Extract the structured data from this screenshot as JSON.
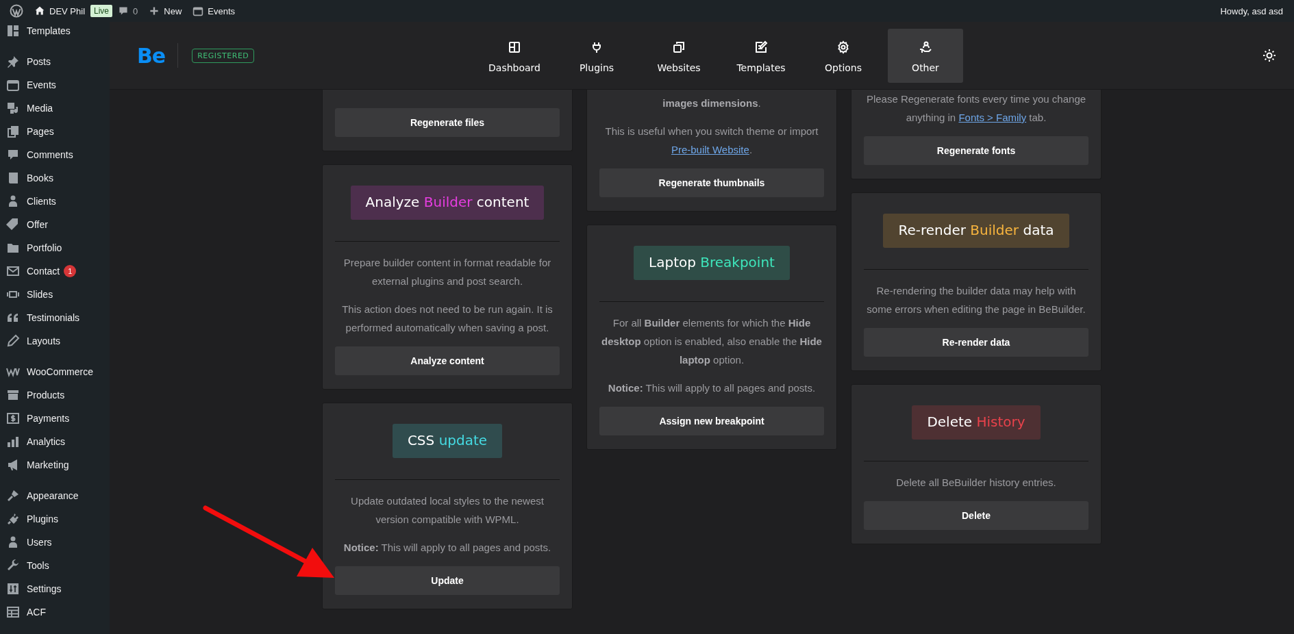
{
  "admin_bar": {
    "site_name": "DEV Phil",
    "live_badge": "Live",
    "comments_count": "0",
    "new_label": "New",
    "events_label": "Events",
    "howdy": "Howdy, asd asd"
  },
  "sidebar": {
    "groups": [
      {
        "items": [
          {
            "label": "Templates"
          }
        ]
      },
      {
        "items": [
          {
            "label": "Posts"
          },
          {
            "label": "Events"
          },
          {
            "label": "Media"
          },
          {
            "label": "Pages"
          },
          {
            "label": "Comments"
          },
          {
            "label": "Books"
          },
          {
            "label": "Clients"
          },
          {
            "label": "Offer"
          },
          {
            "label": "Portfolio"
          },
          {
            "label": "Contact",
            "badge": "1"
          },
          {
            "label": "Slides"
          },
          {
            "label": "Testimonials"
          },
          {
            "label": "Layouts"
          }
        ]
      },
      {
        "items": [
          {
            "label": "WooCommerce"
          },
          {
            "label": "Products"
          },
          {
            "label": "Payments"
          },
          {
            "label": "Analytics"
          },
          {
            "label": "Marketing"
          }
        ]
      },
      {
        "items": [
          {
            "label": "Appearance"
          },
          {
            "label": "Plugins"
          },
          {
            "label": "Users"
          },
          {
            "label": "Tools"
          },
          {
            "label": "Settings"
          },
          {
            "label": "ACF"
          }
        ]
      }
    ]
  },
  "header": {
    "logo": "Be",
    "status_badge": "REGISTERED",
    "tabs": [
      {
        "label": "Dashboard",
        "selected": false
      },
      {
        "label": "Plugins",
        "selected": false
      },
      {
        "label": "Websites",
        "selected": false
      },
      {
        "label": "Templates",
        "selected": false
      },
      {
        "label": "Options",
        "selected": false
      },
      {
        "label": "Other",
        "selected": true
      }
    ]
  },
  "columns": [
    {
      "cards": [
        {
          "kind": "partial",
          "button": "Regenerate files"
        },
        {
          "kind": "full",
          "title": {
            "before": "Analyze ",
            "accent": "Builder",
            "after": " content"
          },
          "color": "#e63de0",
          "paragraphs": [
            {
              "text": "Prepare builder content in format readable for external plugins and post search."
            },
            {
              "text": "This action does not need to be run again. It is performed automatically when saving a post."
            }
          ],
          "button": "Analyze content"
        },
        {
          "kind": "full",
          "title": {
            "before": "CSS ",
            "accent": "update"
          },
          "color": "#45dbe3",
          "paragraphs": [
            {
              "text": "Update outdated local styles to the newest version compatible with WPML."
            },
            {
              "text": "**Notice:** This will apply to all pages and posts."
            }
          ],
          "button": "Update"
        }
      ]
    },
    {
      "cards": [
        {
          "kind": "partial",
          "paragraphs": [
            {
              "text": "**images dimensions**."
            },
            {
              "text": "This is useful when you switch theme or import ",
              "link": "Pre-built Website",
              "after": "."
            }
          ],
          "button": "Regenerate thumbnails"
        },
        {
          "kind": "full",
          "title": {
            "before": "Laptop ",
            "accent": "Breakpoint"
          },
          "color": "#3ee6bc",
          "paragraphs": [
            {
              "text": "For all **Builder** elements for which the **Hide desktop** option is enabled, also enable the **Hide laptop** option."
            },
            {
              "text": "**Notice:** This will apply to all pages and posts."
            }
          ],
          "button": "Assign new breakpoint"
        }
      ]
    },
    {
      "cards": [
        {
          "kind": "partial",
          "paragraphs": [
            {
              "text": "Please Regenerate fonts every time you change anything in ",
              "link": "Fonts > Family",
              "after": " tab."
            }
          ],
          "button": "Regenerate fonts"
        },
        {
          "kind": "full",
          "title": {
            "before": "Re-render ",
            "accent": "Builder",
            "after": " data"
          },
          "color": "#f7b43e",
          "paragraphs": [
            {
              "text": "Re-rendering the builder data may help with some errors when editing the page in BeBuilder."
            }
          ],
          "button": "Re-render data"
        },
        {
          "kind": "full",
          "title": {
            "before": "Delete ",
            "accent": "History"
          },
          "color": "#e8424b",
          "paragraphs": [
            {
              "text": "Delete all BeBuilder history entries."
            }
          ],
          "button": "Delete"
        }
      ]
    }
  ]
}
